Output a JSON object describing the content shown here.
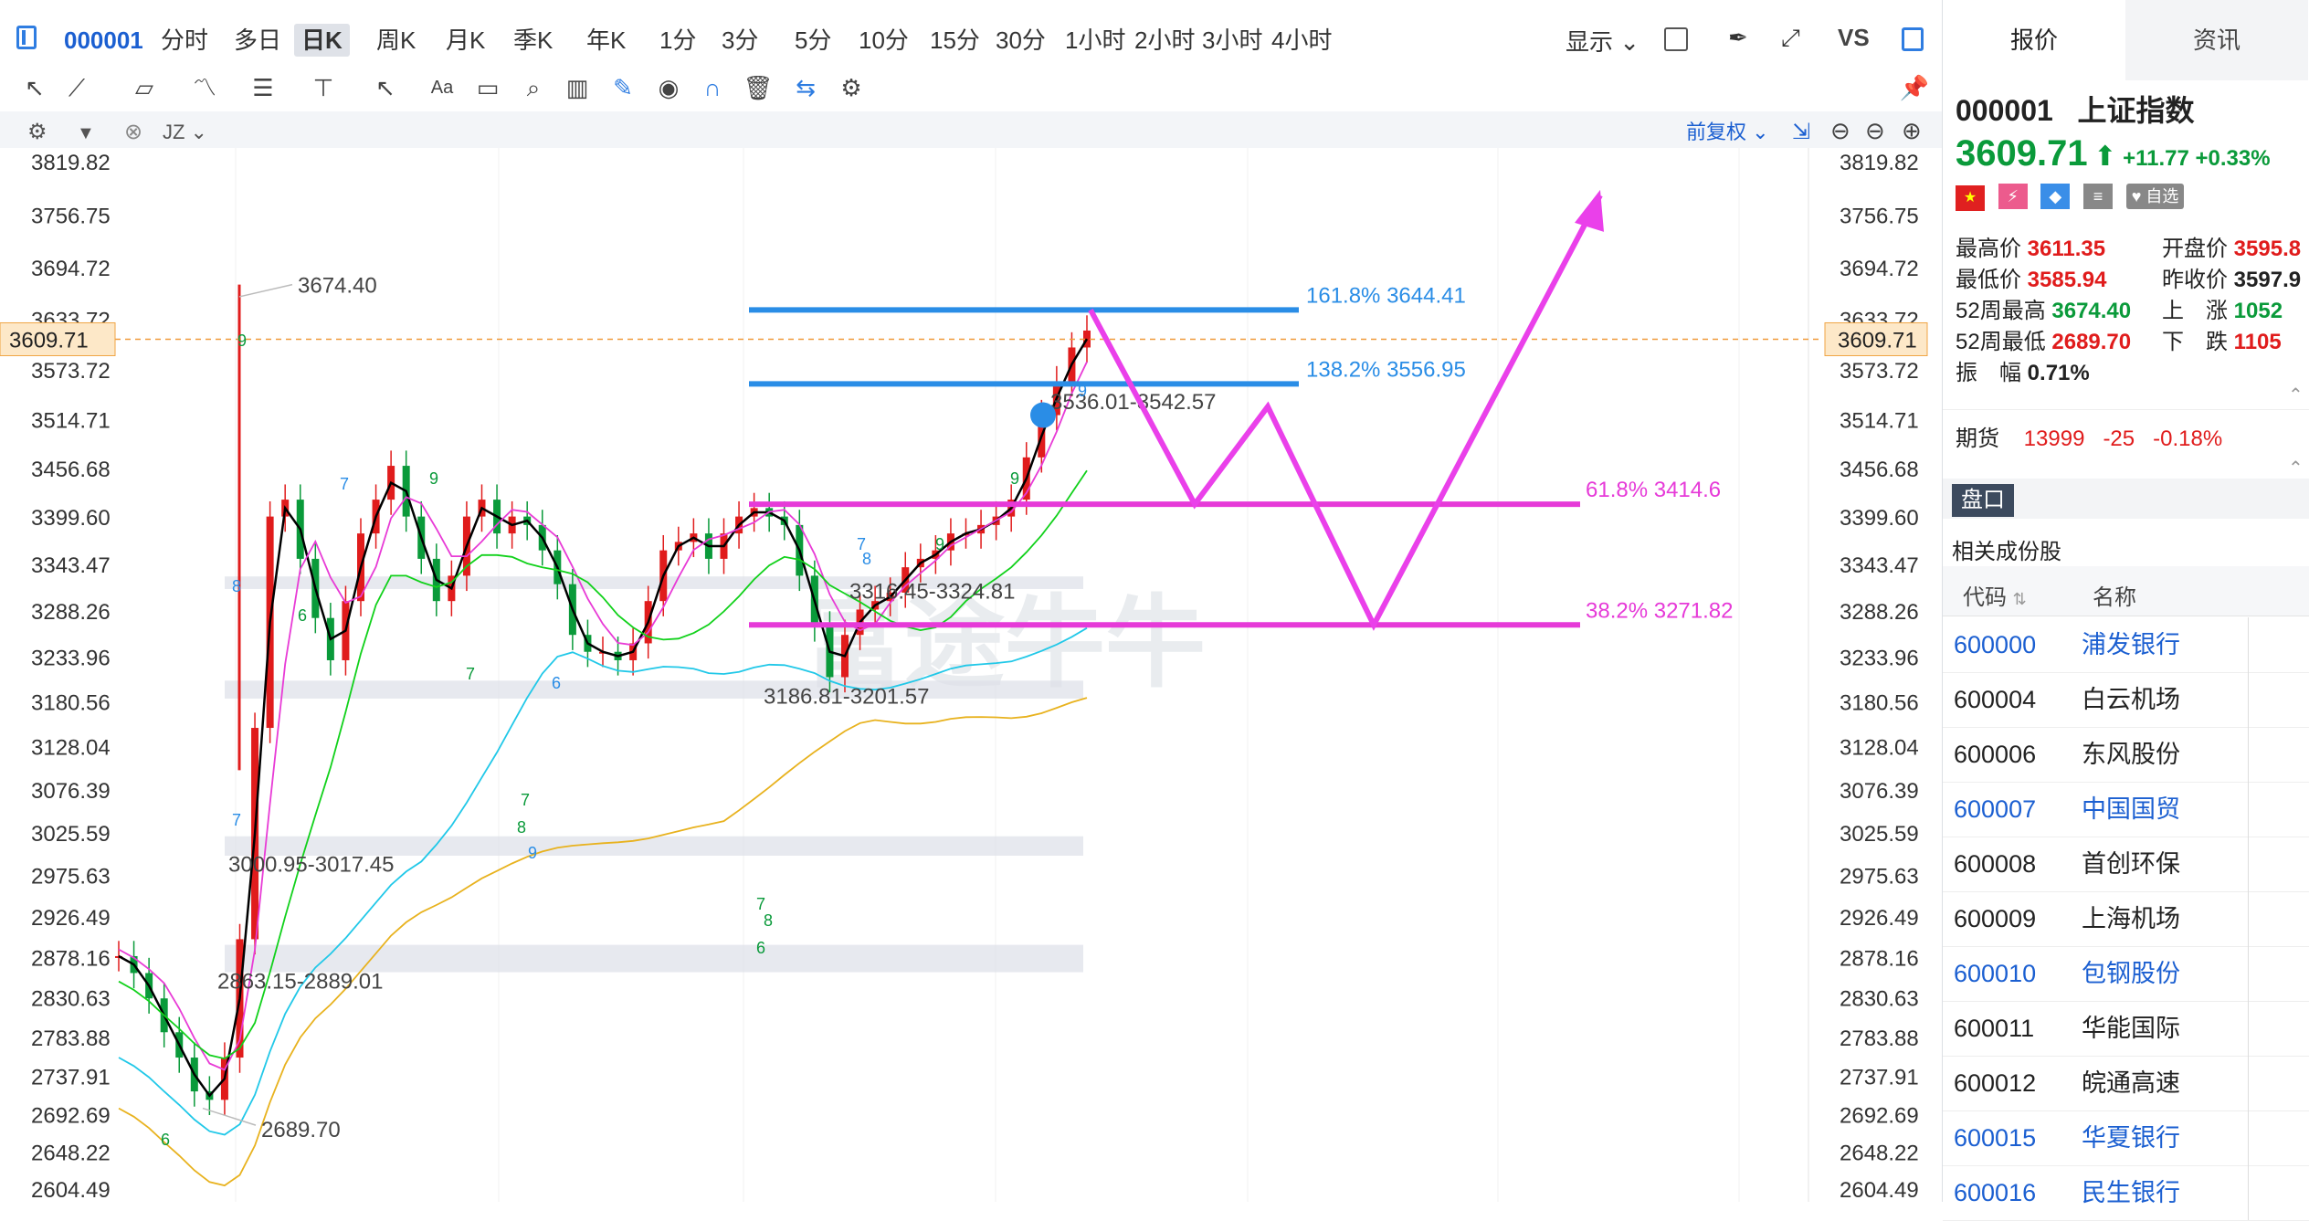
{
  "toolbar": {
    "code": "000001",
    "periods": [
      "分时",
      "多日",
      "日K",
      "周K",
      "月K",
      "季K",
      "年K",
      "1分",
      "3分",
      "5分",
      "10分",
      "15分",
      "30分",
      "1小时",
      "2小时",
      "3小时",
      "4小时"
    ],
    "active_period": "日K",
    "display_label": "显示",
    "vs_label": "VS"
  },
  "chart_header": {
    "indicator": "JZ",
    "adjust": "前复权"
  },
  "price_axis": [
    "3819.82",
    "3756.75",
    "3694.72",
    "3633.72",
    "3573.72",
    "3514.71",
    "3456.68",
    "3399.60",
    "3343.47",
    "3288.26",
    "3233.96",
    "3180.56",
    "3128.04",
    "3076.39",
    "3025.59",
    "2975.63",
    "2926.49",
    "2878.16",
    "2830.63",
    "2783.88",
    "2737.91",
    "2692.69",
    "2648.22",
    "2604.49"
  ],
  "current_price_tag": "3609.71",
  "annotations": {
    "high": "3674.40",
    "low": "2689.70",
    "zone1": "3000.95-3017.45",
    "zone2": "2863.15-2889.01",
    "zone3": "3186.81-3201.57",
    "zone4": "3316.45-3324.81",
    "zone5": "3536.01-3542.57",
    "fib1618": "161.8% 3644.41",
    "fib1382": "138.2% 3556.95",
    "fib618": "61.8% 3414.6",
    "fib382": "38.2% 3271.82",
    "watermark": "富途牛牛"
  },
  "chart_data": {
    "type": "line",
    "title": "",
    "xlabel": "",
    "ylabel": "",
    "ylim": [
      2604.49,
      3819.82
    ],
    "series": [
      {
        "name": "",
        "points": [
          2880,
          2860,
          2830,
          2790,
          2760,
          2720,
          2710,
          2760,
          2900,
          3150,
          3400,
          3420,
          3350,
          3280,
          3230,
          3300,
          3380,
          3420,
          3460,
          3400,
          3350,
          3300,
          3330,
          3400,
          3420,
          3380,
          3400,
          3390,
          3360,
          3320,
          3260,
          3240,
          3240,
          3230,
          3250,
          3300,
          3360,
          3370,
          3380,
          3350,
          3380,
          3400,
          3410,
          3400,
          3390,
          3330,
          3270,
          3210,
          3260,
          3290,
          3300,
          3310,
          3340,
          3350,
          3360,
          3380,
          3380,
          3390,
          3400,
          3420,
          3470,
          3520,
          3560,
          3600,
          3620
        ]
      }
    ],
    "forecast_path": [
      3644.41,
      3414.6,
      3530,
      3271.82,
      3780
    ]
  },
  "quote": {
    "tab_quote": "报价",
    "tab_news": "资讯",
    "code": "000001",
    "name": "上证指数",
    "price": "3609.71",
    "change": "+11.77",
    "change_pct": "+0.33%",
    "watch_label": "自选",
    "high_label": "最高价",
    "high": "3611.35",
    "open_label": "开盘价",
    "open": "3595.8",
    "low_label": "最低价",
    "low": "3585.94",
    "prev_label": "昨收价",
    "prev": "3597.9",
    "w52h_label": "52周最高",
    "w52h": "3674.40",
    "up_label": "上　涨",
    "up": "1052",
    "w52l_label": "52周最低",
    "w52l": "2689.70",
    "down_label": "下　跌",
    "down": "1105",
    "amp_label": "振　幅",
    "amp": "0.71%",
    "fut_label": "期货",
    "fut_price": "13999",
    "fut_chg": "-25",
    "fut_pct": "-0.18%",
    "pankou_label": "盘口",
    "related_label": "相关成份股",
    "col_code": "代码",
    "col_name": "名称",
    "stocks": [
      {
        "code": "600000",
        "name": "浦发银行",
        "link": true
      },
      {
        "code": "600004",
        "name": "白云机场",
        "link": false
      },
      {
        "code": "600006",
        "name": "东风股份",
        "link": false
      },
      {
        "code": "600007",
        "name": "中国国贸",
        "link": true
      },
      {
        "code": "600008",
        "name": "首创环保",
        "link": false
      },
      {
        "code": "600009",
        "name": "上海机场",
        "link": false
      },
      {
        "code": "600010",
        "name": "包钢股份",
        "link": true
      },
      {
        "code": "600011",
        "name": "华能国际",
        "link": false
      },
      {
        "code": "600012",
        "name": "皖通高速",
        "link": false
      },
      {
        "code": "600015",
        "name": "华夏银行",
        "link": true
      },
      {
        "code": "600016",
        "name": "民生银行",
        "link": true
      }
    ]
  }
}
